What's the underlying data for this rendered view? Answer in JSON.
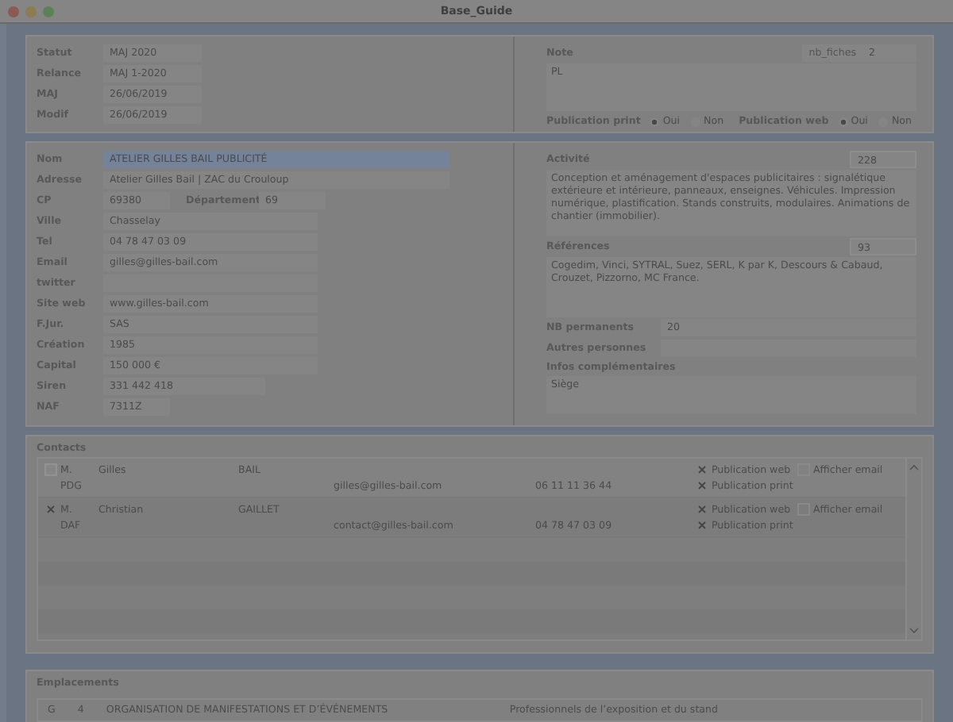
{
  "window": {
    "title": "Base_Guide"
  },
  "status": {
    "fields": [
      {
        "label": "Statut",
        "value": "MAJ 2020"
      },
      {
        "label": "Relance",
        "value": "MAJ 1-2020"
      },
      {
        "label": "MAJ",
        "value": "26/06/2019"
      },
      {
        "label": "Modif",
        "value": "26/06/2019"
      }
    ],
    "note": {
      "label": "Note",
      "count_label": "nb_fiches",
      "count": "2",
      "value": "PL"
    },
    "publications": [
      {
        "label": "Publication print",
        "options": [
          {
            "label": "Oui",
            "selected": true
          },
          {
            "label": "Non",
            "selected": false
          }
        ]
      },
      {
        "label": "Publication web",
        "options": [
          {
            "label": "Oui",
            "selected": true
          },
          {
            "label": "Non",
            "selected": false
          }
        ]
      }
    ]
  },
  "company": {
    "fields": [
      {
        "label": "Nom",
        "value": "ATELIER GILLES BAIL PUBLICITÉ",
        "focused": true
      },
      {
        "label": "Adresse",
        "value": "Atelier Gilles Bail | ZAC du Crouloup",
        "focused": false
      },
      {
        "label": "CP",
        "value": "69380",
        "focused": false,
        "extra_label": "Département",
        "extra_value": "69"
      },
      {
        "label": "Ville",
        "value": "Chasselay",
        "focused": false
      },
      {
        "label": "Tel",
        "value": "04 78 47 03 09",
        "focused": false
      },
      {
        "label": "Email",
        "value": "gilles@gilles-bail.com",
        "focused": false
      },
      {
        "label": "twitter",
        "focused": false
      },
      {
        "label": "Site web",
        "value": "www.gilles-bail.com",
        "focused": false
      },
      {
        "label": "F.Jur.",
        "value": "SAS",
        "focused": false
      },
      {
        "label": "Création",
        "value": "1985",
        "focused": false
      },
      {
        "label": "Capital",
        "value": "150 000 €",
        "focused": false
      },
      {
        "label": "Siren",
        "value": "331 442 418",
        "focused": false
      },
      {
        "label": "NAF",
        "value": "7311Z",
        "focused": false
      }
    ],
    "activity": {
      "label": "Activité",
      "count": "228",
      "text": "Conception et aménagement d'espaces publicitaires : signalétique extérieure et intérieure, panneaux, enseignes. Véhicules. Impression numérique, plastification. Stands construits, modulaires. Animations de chantier (immobilier)."
    },
    "references": {
      "label": "Références",
      "count": "93",
      "text": "Cogedim, Vinci, SYTRAL, Suez, SERL, K par K, Descours & Cabaud, Crouzet, Pizzorno, MC France."
    },
    "staff": [
      {
        "label": "NB permanents",
        "value": "20"
      },
      {
        "label": "Autres personnes"
      }
    ],
    "info": {
      "label": "Infos complémentaires",
      "text": "Siège"
    }
  },
  "contacts": {
    "title": "Contacts",
    "rows": [
      {
        "checked": false,
        "civility": "M.",
        "first_name": "Gilles",
        "last_name": "BAIL",
        "role": "PDG",
        "email": "gilles@gilles-bail.com",
        "phone": "06 11 11 36 44",
        "options": [
          {
            "label": "Publication web",
            "checked": true
          },
          {
            "label": "Publication print",
            "checked": true
          }
        ],
        "show_email": {
          "label": "Afficher email",
          "checked": false
        }
      },
      {
        "checked": true,
        "civility": "M.",
        "first_name": "Christian",
        "last_name": "GAILLET",
        "role": "DAF",
        "email": "contact@gilles-bail.com",
        "phone": "04 78 47 03 09",
        "options": [
          {
            "label": "Publication web",
            "checked": true
          },
          {
            "label": "Publication print",
            "checked": true
          }
        ],
        "show_email": {
          "label": "Afficher email",
          "checked": false
        }
      }
    ]
  },
  "locations": {
    "title": "Emplacements",
    "rows": [
      {
        "code": "G",
        "number": "4",
        "category": "ORGANISATION DE MANIFESTATIONS ET D’ÉVÉNEMENTS",
        "subcategory": "Professionnels de l’exposition et du stand"
      }
    ]
  }
}
